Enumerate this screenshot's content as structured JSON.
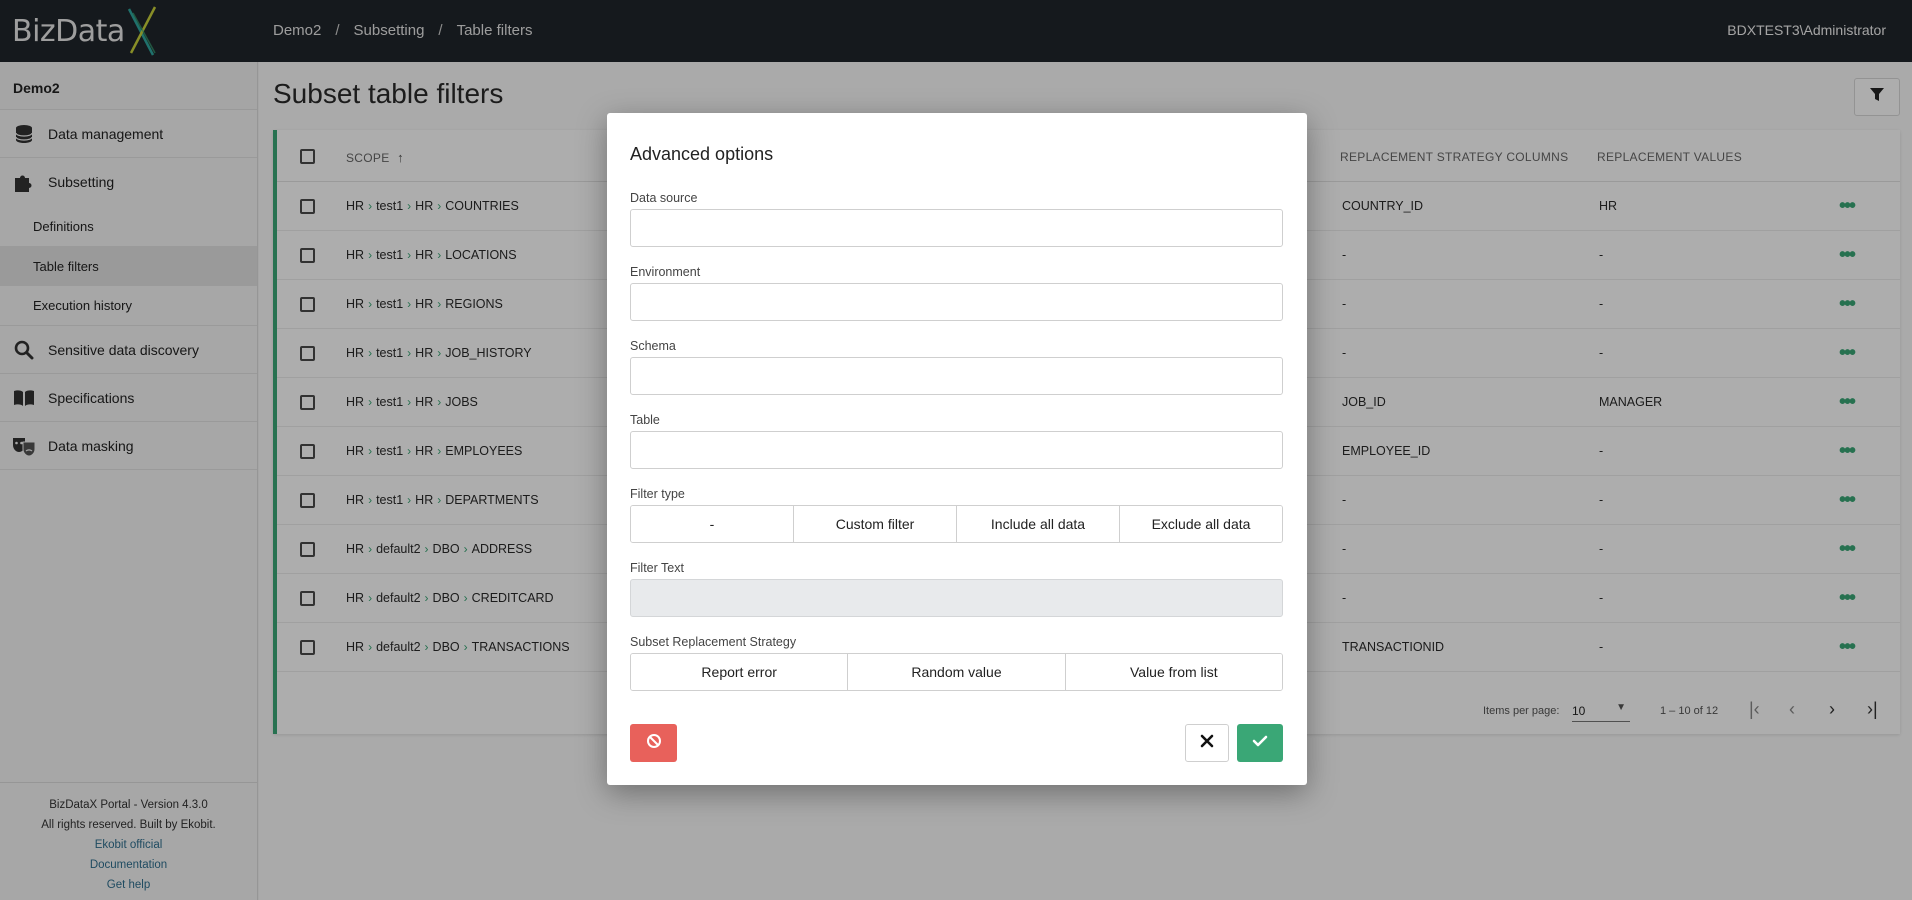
{
  "topbar": {
    "logo": "BizData",
    "breadcrumb": [
      "Demo2",
      "Subsetting",
      "Table filters"
    ],
    "separator": "/",
    "user": "BDXTEST3\\Administrator"
  },
  "sidebar": {
    "project": "Demo2",
    "items": [
      {
        "label": "Data management",
        "icon": "database-icon"
      },
      {
        "label": "Subsetting",
        "icon": "puzzle-icon"
      },
      {
        "label": "Sensitive data discovery",
        "icon": "search-icon"
      },
      {
        "label": "Specifications",
        "icon": "book-icon"
      },
      {
        "label": "Data masking",
        "icon": "masks-icon"
      }
    ],
    "subitems": [
      "Definitions",
      "Table filters",
      "Execution history"
    ],
    "active_subitem": "Table filters",
    "footer": {
      "version": "BizDataX Portal - Version 4.3.0",
      "rights": "All rights reserved. Built by Ekobit.",
      "links": [
        "Ekobit official",
        "Documentation",
        "Get help"
      ]
    }
  },
  "main": {
    "title": "Subset table filters",
    "columns": {
      "scope": "SCOPE",
      "strategy": "REPLACEMENT STRATEGY COLUMNS",
      "values": "REPLACEMENT VALUES"
    },
    "rows": [
      {
        "scope": [
          "HR",
          "test1",
          "HR",
          "COUNTRIES"
        ],
        "strategy": "COUNTRY_ID",
        "value": "HR"
      },
      {
        "scope": [
          "HR",
          "test1",
          "HR",
          "LOCATIONS"
        ],
        "strategy": "-",
        "value": "-"
      },
      {
        "scope": [
          "HR",
          "test1",
          "HR",
          "REGIONS"
        ],
        "strategy": "-",
        "value": "-"
      },
      {
        "scope": [
          "HR",
          "test1",
          "HR",
          "JOB_HISTORY"
        ],
        "strategy": "-",
        "value": "-"
      },
      {
        "scope": [
          "HR",
          "test1",
          "HR",
          "JOBS"
        ],
        "strategy": "JOB_ID",
        "value": "MANAGER"
      },
      {
        "scope": [
          "HR",
          "test1",
          "HR",
          "EMPLOYEES"
        ],
        "strategy": "EMPLOYEE_ID",
        "value": "-"
      },
      {
        "scope": [
          "HR",
          "test1",
          "HR",
          "DEPARTMENTS"
        ],
        "strategy": "-",
        "value": "-"
      },
      {
        "scope": [
          "HR",
          "default2",
          "DBO",
          "ADDRESS"
        ],
        "strategy": "-",
        "value": "-"
      },
      {
        "scope": [
          "HR",
          "default2",
          "DBO",
          "CREDITCARD"
        ],
        "strategy": "-",
        "value": "-"
      },
      {
        "scope": [
          "HR",
          "default2",
          "DBO",
          "TRANSACTIONS"
        ],
        "strategy": "TRANSACTIONID",
        "value": "-"
      }
    ],
    "pager": {
      "items_per_page_label": "Items per page:",
      "items_per_page": "10",
      "range": "1 – 10 of 12"
    }
  },
  "modal": {
    "title": "Advanced options",
    "fields": {
      "data_source": {
        "label": "Data source",
        "value": ""
      },
      "environment": {
        "label": "Environment",
        "value": ""
      },
      "schema": {
        "label": "Schema",
        "value": ""
      },
      "table": {
        "label": "Table",
        "value": ""
      }
    },
    "filter_type": {
      "label": "Filter type",
      "options": [
        "-",
        "Custom filter",
        "Include all data",
        "Exclude all data"
      ]
    },
    "filter_text": {
      "label": "Filter Text",
      "value": ""
    },
    "replacement": {
      "label": "Subset Replacement Strategy",
      "options": [
        "Report error",
        "Random value",
        "Value from list"
      ]
    }
  },
  "colors": {
    "accent": "#3aa776",
    "danger": "#e8615b",
    "topbar": "#20252b",
    "logo_x": "#3aa776"
  }
}
